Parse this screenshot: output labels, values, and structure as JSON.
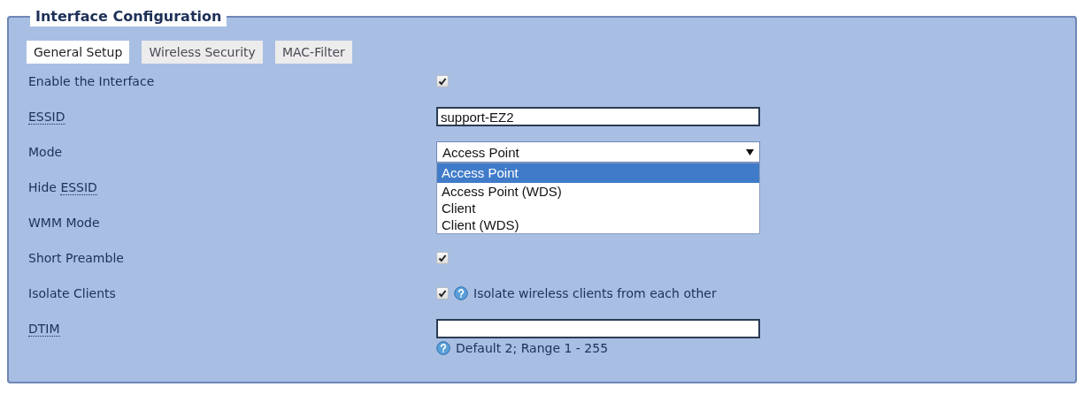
{
  "section": {
    "title": "Interface Configuration"
  },
  "tabs": [
    {
      "label": "General Setup",
      "selected": true
    },
    {
      "label": "Wireless Security",
      "selected": false
    },
    {
      "label": "MAC-Filter",
      "selected": false
    }
  ],
  "rows": [
    {
      "kind": "checkbox",
      "label_parts": [
        {
          "text": "Enable the Interface",
          "abbr": false
        }
      ],
      "checked": true
    },
    {
      "kind": "text",
      "label_parts": [
        {
          "text": "ESSID",
          "abbr": true
        }
      ],
      "value": "support-EZ2"
    },
    {
      "kind": "select",
      "label_parts": [
        {
          "text": "Mode",
          "abbr": false
        }
      ],
      "value": "Access Point",
      "expanded": true,
      "options": [
        {
          "label": "Access Point",
          "selected": true
        },
        {
          "label": "Access Point (WDS)",
          "selected": false
        },
        {
          "label": "Client",
          "selected": false
        },
        {
          "label": "Client (WDS)",
          "selected": false
        }
      ]
    },
    {
      "kind": "covered",
      "label_parts": [
        {
          "text": "Hide ",
          "abbr": false
        },
        {
          "text": "ESSID",
          "abbr": true
        }
      ]
    },
    {
      "kind": "covered",
      "label_parts": [
        {
          "text": "WMM Mode",
          "abbr": false
        }
      ]
    },
    {
      "kind": "checkbox",
      "label_parts": [
        {
          "text": "Short Preamble",
          "abbr": false
        }
      ],
      "checked": true
    },
    {
      "kind": "checkbox",
      "label_parts": [
        {
          "text": "Isolate Clients",
          "abbr": false
        }
      ],
      "checked": true,
      "help": "Isolate wireless clients from each other"
    },
    {
      "kind": "text",
      "label_parts": [
        {
          "text": "DTIM",
          "abbr": true
        }
      ],
      "hint": "Default 2; Range 1 - 255"
    }
  ]
}
